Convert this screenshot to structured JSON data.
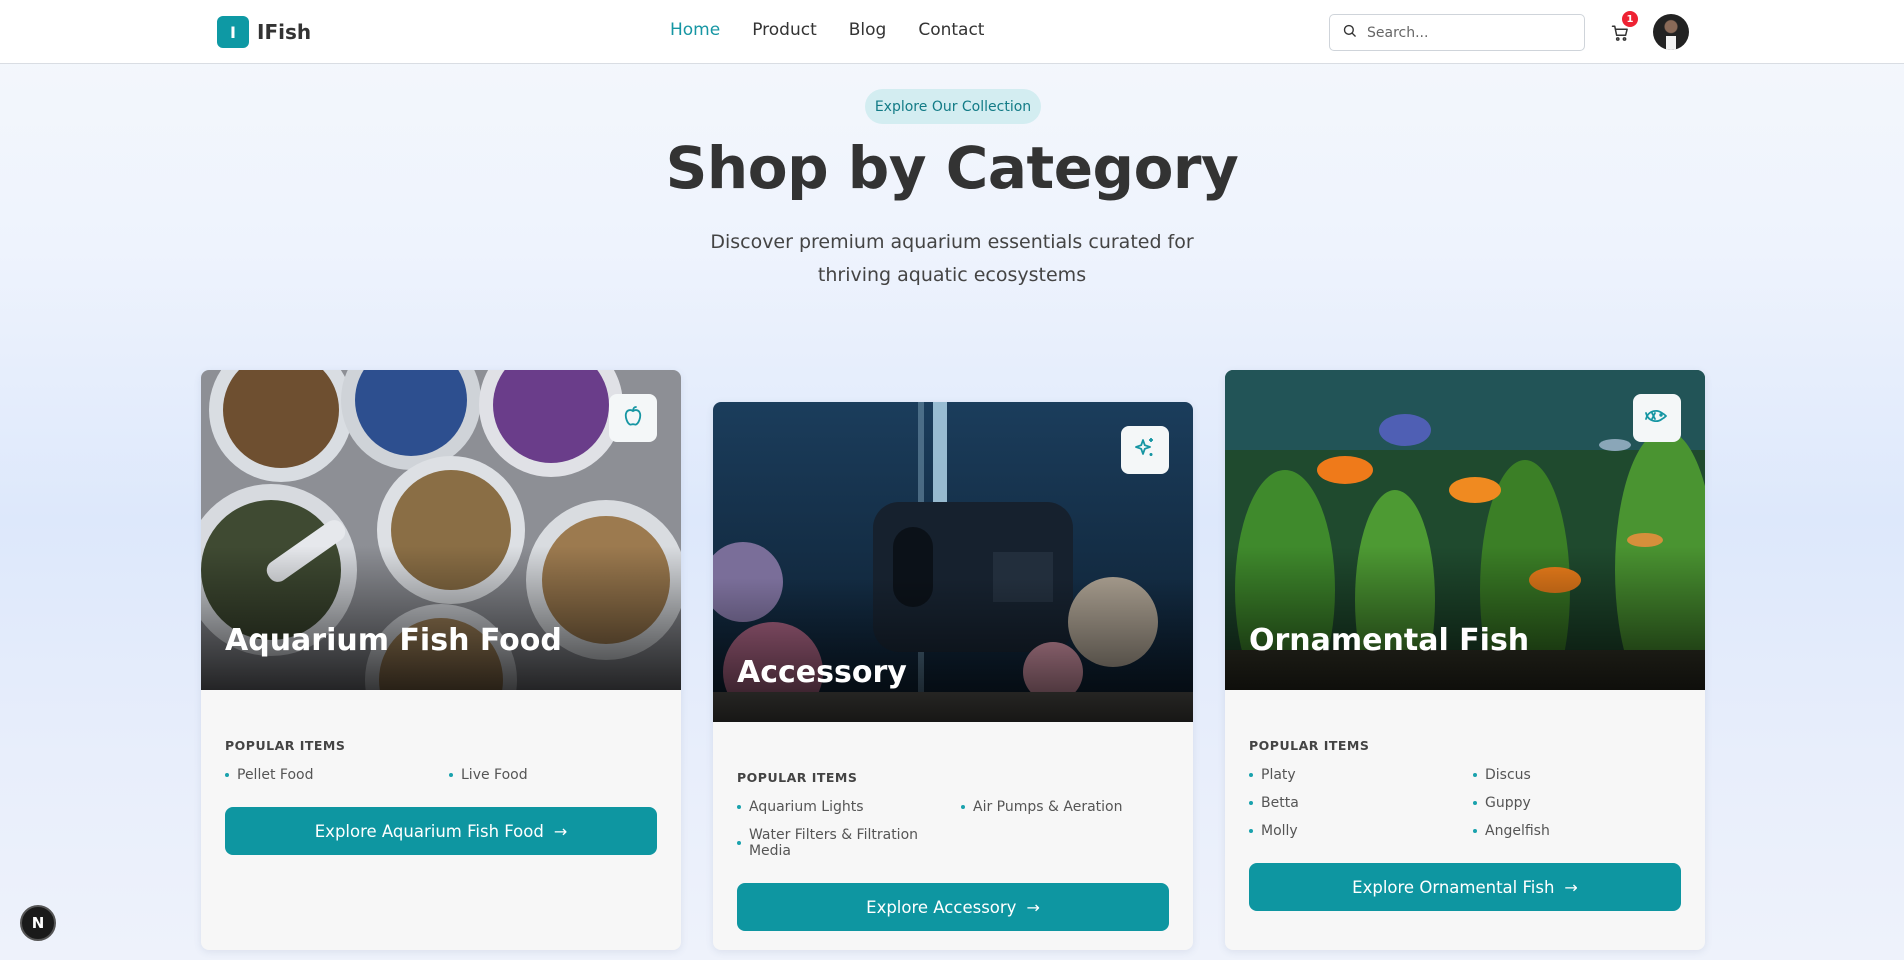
{
  "nav": {
    "logo_letter": "I",
    "logo_text": "IFish",
    "links": [
      {
        "label": "Home",
        "active": true
      },
      {
        "label": "Product",
        "active": false
      },
      {
        "label": "Blog",
        "active": false
      },
      {
        "label": "Contact",
        "active": false
      }
    ],
    "search_placeholder": "Search...",
    "cart_count": "1"
  },
  "hero": {
    "pill": "Explore Our Collection",
    "title": "Shop by Category",
    "subtitle": "Discover premium aquarium essentials curated for thriving aquatic ecosystems"
  },
  "cards": [
    {
      "title": "Aquarium Fish Food",
      "icon": "apple-icon",
      "popular_label": "POPULAR ITEMS",
      "items": [
        "Pellet Food",
        "Live Food"
      ],
      "button": "Explore Aquarium Fish Food"
    },
    {
      "title": "Accessory",
      "icon": "sparkles-icon",
      "popular_label": "POPULAR ITEMS",
      "items": [
        "Aquarium Lights",
        "Air Pumps & Aeration",
        "Water Filters & Filtration Media"
      ],
      "button": "Explore Accessory"
    },
    {
      "title": "Ornamental Fish",
      "icon": "fish-icon",
      "popular_label": "POPULAR ITEMS",
      "items": [
        "Platy",
        "Discus",
        "Betta",
        "Guppy",
        "Molly",
        "Angelfish"
      ],
      "button": "Explore Ornamental Fish"
    }
  ],
  "dev_badge": "N",
  "colors": {
    "accent": "#0e96a1",
    "pill_bg": "#d3edf1",
    "cart_badge": "#ee2233"
  }
}
